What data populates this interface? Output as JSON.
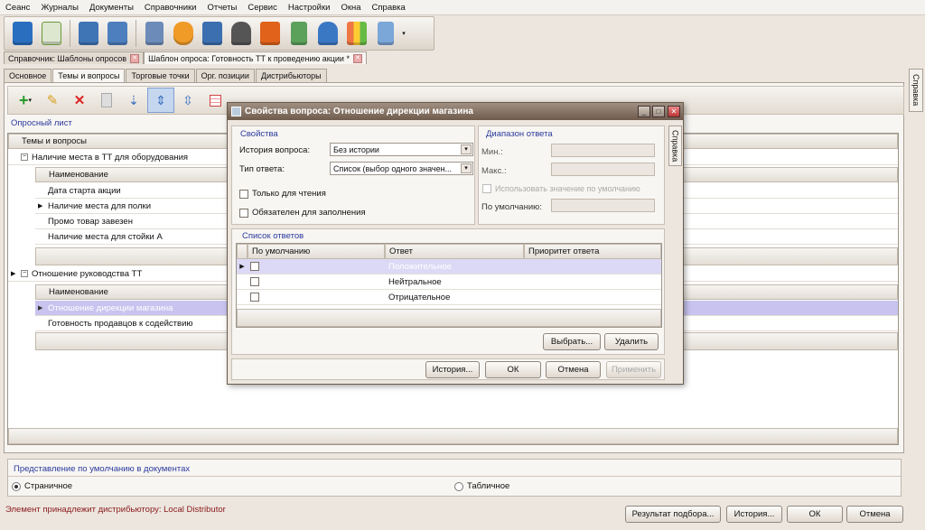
{
  "menu": [
    "Сеанс",
    "Журналы",
    "Документы",
    "Справочники",
    "Отчеты",
    "Сервис",
    "Настройки",
    "Окна",
    "Справка"
  ],
  "toolbar_icons": [
    "book-icon",
    "checklist-icon",
    "door-exit-icon",
    "door-enter-icon",
    "chart-user-icon",
    "people-icon",
    "house-icon",
    "person-icon",
    "presentation-icon",
    "calculator-icon",
    "manager-icon",
    "bar-chart-icon",
    "network-icon"
  ],
  "doc_tabs": [
    {
      "label": "Справочник: Шаблоны опросов",
      "active": false
    },
    {
      "label": "Шаблон опроса: Готовность ТТ к проведению акции *",
      "active": true
    }
  ],
  "page_tabs": [
    "Основное",
    "Темы и вопросы",
    "Торговые точки",
    "Орг. позиции",
    "Дистрибьюторы"
  ],
  "side_tab": "Справка",
  "survey_sheet_label": "Опросный лист",
  "topics_header": "Темы и вопросы",
  "topics": [
    {
      "label": "Наличие места в ТТ для оборудования",
      "name_header": "Наименование",
      "questions": [
        "Дата старта акции",
        "Наличие места для полки",
        "Промо товар завезен",
        "Наличие места для стойки А"
      ]
    },
    {
      "label": "Отношение руководства ТТ",
      "name_header": "Наименование",
      "questions": [
        "Отношение дирекции магазина",
        "Готовность продавцов к содействию"
      ]
    }
  ],
  "default_view": {
    "title": "Представление по умолчанию в документах",
    "options": [
      "Страничное",
      "Табличное"
    ],
    "selected": "Страничное"
  },
  "status_text": "Элемент принадлежит дистрибьютору: Local Distributor",
  "bottom_buttons": [
    "Результат подбора...",
    "История...",
    "ОК",
    "Отмена"
  ],
  "dialog": {
    "title": "Свойства вопроса: Отношение дирекции магазина",
    "side_tab": "Справка",
    "props": {
      "title": "Свойства",
      "history_label": "История вопроса:",
      "history_value": "Без истории",
      "type_label": "Тип ответа:",
      "type_value": "Список (выбор одного значен...",
      "readonly_label": "Только для чтения",
      "required_label": "Обязателен для заполнения"
    },
    "range": {
      "title": "Диапазон ответа",
      "min_label": "Мин.:",
      "max_label": "Макс.:",
      "use_default_label": "Использовать значение по умолчанию",
      "default_label": "По умолчанию:"
    },
    "answers": {
      "title": "Список ответов",
      "columns": [
        "По умолчанию",
        "Ответ",
        "Приоритет ответа"
      ],
      "rows": [
        "Положительное",
        "Нейтральное",
        "Отрицательное"
      ]
    },
    "buttons": {
      "choose": "Выбрать...",
      "delete": "Удалить",
      "history": "История...",
      "ok": "ОК",
      "cancel": "Отмена",
      "apply": "Применить"
    }
  }
}
